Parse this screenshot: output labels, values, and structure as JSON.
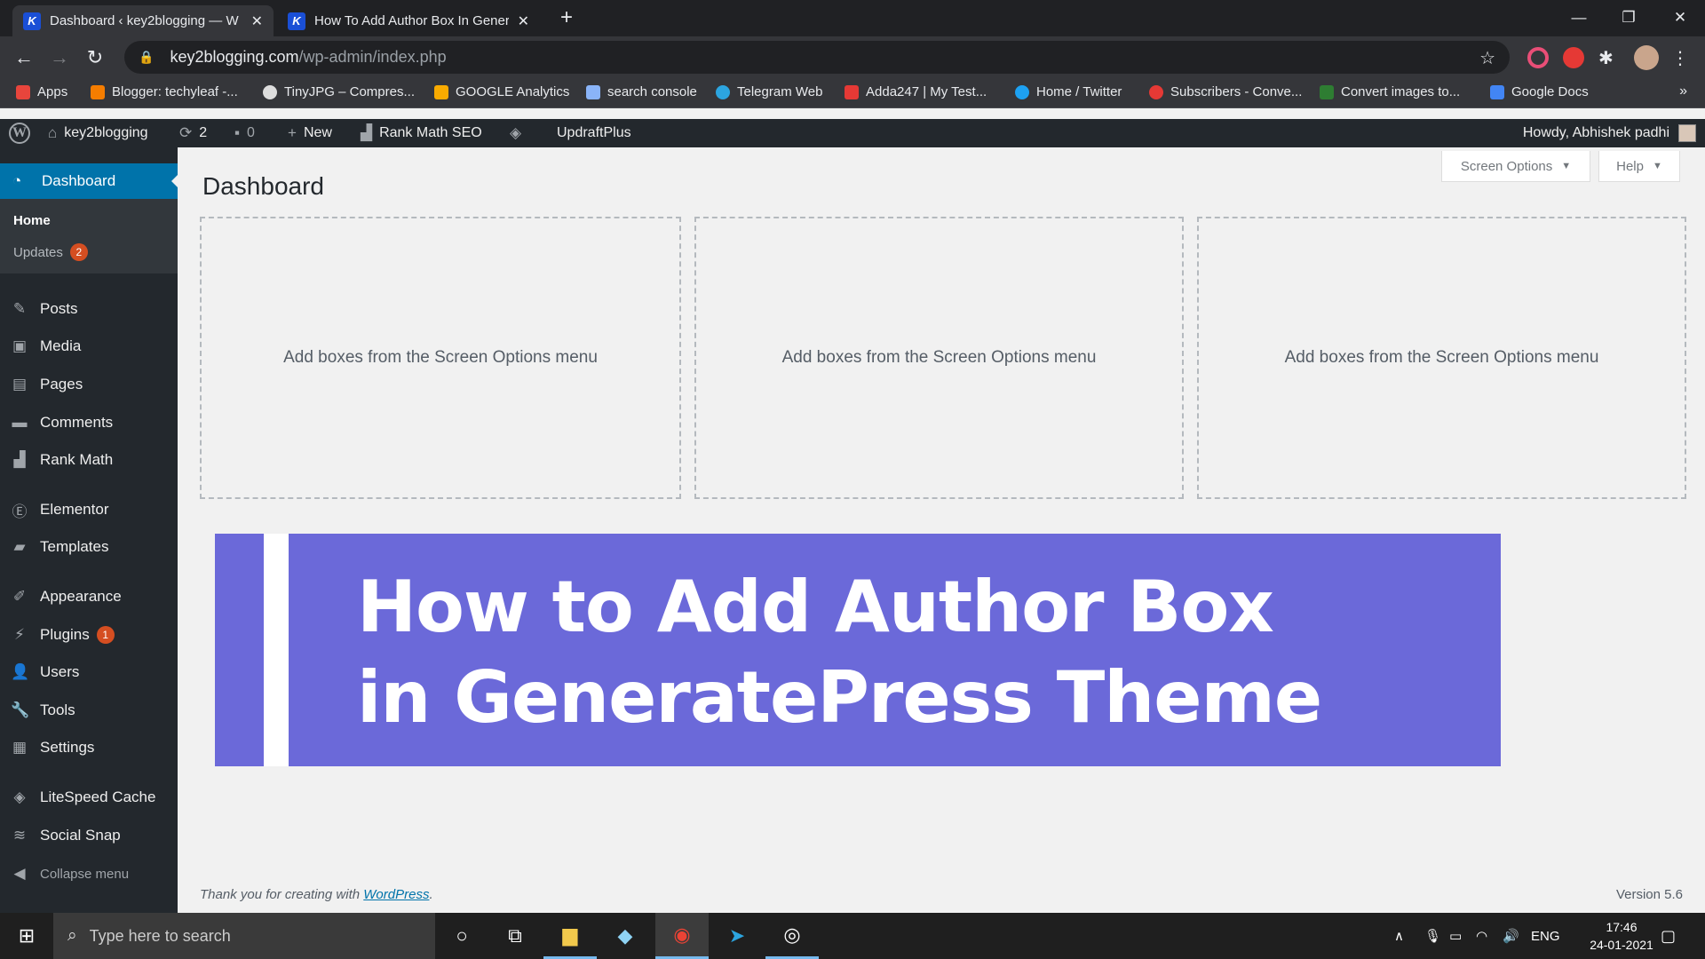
{
  "browser": {
    "tabs": [
      {
        "title": "Dashboard ‹ key2blogging — W",
        "favicon": "K"
      },
      {
        "title": "How To Add Author Box In Gener",
        "favicon": "K"
      }
    ],
    "url_domain": "key2blogging.com",
    "url_path": "/wp-admin/index.php",
    "bookmarks": [
      {
        "label": "Apps",
        "color": "#e8453c"
      },
      {
        "label": "Blogger: techyleaf -...",
        "color": "#f57d00"
      },
      {
        "label": "TinyJPG – Compres...",
        "color": "#dddddd"
      },
      {
        "label": "GOOGLE Analytics",
        "color": "#f9ab00"
      },
      {
        "label": "search console",
        "color": "#8ab4f8"
      },
      {
        "label": "Telegram Web",
        "color": "#2ca5e0"
      },
      {
        "label": "Adda247 | My Test...",
        "color": "#e53935"
      },
      {
        "label": "Home / Twitter",
        "color": "#1da1f2"
      },
      {
        "label": "Subscribers - Conve...",
        "color": "#e53935"
      },
      {
        "label": "Convert images to...",
        "color": "#2e7d32"
      },
      {
        "label": "Google Docs",
        "color": "#4285f4"
      }
    ]
  },
  "adminbar": {
    "site": "key2blogging",
    "updates_count": "2",
    "comments_count": "0",
    "new_label": "New",
    "rankmath_label": "Rank Math SEO",
    "updraft_label": "UpdraftPlus",
    "howdy": "Howdy, Abhishek padhi"
  },
  "sidebar": {
    "dashboard": "Dashboard",
    "home": "Home",
    "updates": "Updates",
    "updates_badge": "2",
    "items": [
      {
        "label": "Posts",
        "icon": "pin-icon"
      },
      {
        "label": "Media",
        "icon": "media-icon"
      },
      {
        "label": "Pages",
        "icon": "pages-icon"
      },
      {
        "label": "Comments",
        "icon": "comments-icon"
      },
      {
        "label": "Rank Math",
        "icon": "chart-icon"
      },
      {
        "label": "Elementor",
        "icon": "elementor-icon"
      },
      {
        "label": "Templates",
        "icon": "folder-icon"
      },
      {
        "label": "Appearance",
        "icon": "brush-icon"
      },
      {
        "label": "Plugins",
        "icon": "plug-icon",
        "badge": "1"
      },
      {
        "label": "Users",
        "icon": "user-icon"
      },
      {
        "label": "Tools",
        "icon": "wrench-icon"
      },
      {
        "label": "Settings",
        "icon": "settings-icon"
      },
      {
        "label": "LiteSpeed Cache",
        "icon": "diamond-icon"
      },
      {
        "label": "Social Snap",
        "icon": "social-icon"
      }
    ],
    "collapse": "Collapse menu"
  },
  "content": {
    "title": "Dashboard",
    "screen_options": "Screen Options",
    "help": "Help",
    "dropzone_text": "Add boxes from the Screen Options menu",
    "banner_line1": "How to Add Author Box",
    "banner_line2": "in GeneratePress Theme",
    "footer_text": "Thank you for creating with ",
    "footer_link": "WordPress",
    "footer_punct": ".",
    "version": "Version 5.6"
  },
  "taskbar": {
    "search_placeholder": "Type here to search",
    "lang": "ENG",
    "time": "17:46",
    "date": "24-01-2021"
  },
  "colors": {
    "wp_blue": "#0073aa",
    "banner": "#6b69d9",
    "badge": "#d54e21"
  }
}
